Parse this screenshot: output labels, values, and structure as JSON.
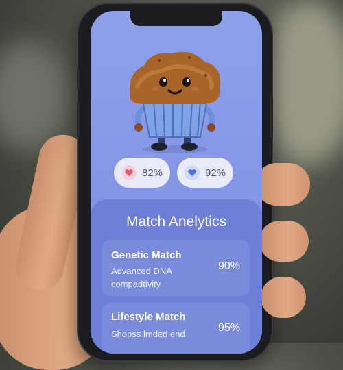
{
  "stats": [
    {
      "icon": "heart-icon",
      "value": "82%",
      "color": "#e05a76"
    },
    {
      "icon": "heart-icon",
      "value": "92%",
      "color": "#4a6fd8"
    }
  ],
  "analytics": {
    "title": "Match Anelytics",
    "cards": [
      {
        "title": "Genetic Match",
        "desc_line1": "Advanced DNA",
        "desc_line2": "compadtivity",
        "value": "90%"
      },
      {
        "title": "Lifestyle Match",
        "desc_line1": "Shopss lmded end",
        "value": "95%"
      }
    ]
  },
  "colors": {
    "screen": "#8496e6",
    "panel": "#6d7fd6",
    "card": "#7a8bdc"
  }
}
